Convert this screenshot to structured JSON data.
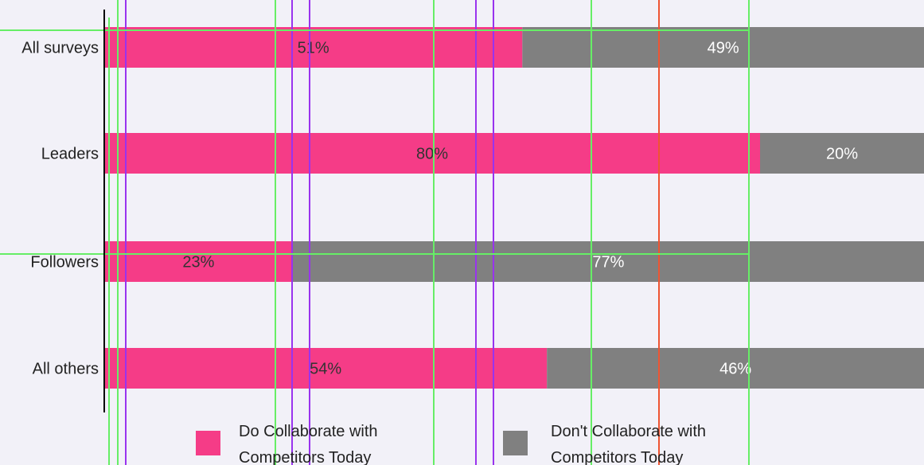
{
  "chart_data": {
    "type": "bar",
    "orientation": "horizontal",
    "stacked": true,
    "normalized_percent": true,
    "categories": [
      "All surveys",
      "Leaders",
      "Followers",
      "All others"
    ],
    "series": [
      {
        "name": "Do Collaborate with Competitors Today",
        "legend_lines": [
          "Do Collaborate with",
          "Competitors Today"
        ],
        "values": [
          51,
          80,
          23,
          54
        ],
        "labels": [
          "51%",
          "80%",
          "23%",
          "54%"
        ],
        "color": "#f53c87",
        "label_color": "#333333"
      },
      {
        "name": "Don't Collaborate with Competitors Today",
        "legend_lines": [
          "Don't Collaborate with",
          "Competitors Today"
        ],
        "values": [
          49,
          20,
          77,
          46
        ],
        "labels": [
          "49%",
          "20%",
          "77%",
          "46%"
        ],
        "color": "#808080",
        "label_color": "#ffffff"
      }
    ],
    "xlim": [
      0,
      100
    ],
    "title": "",
    "xlabel": "",
    "ylabel": "",
    "grid": false,
    "legend_position": "bottom",
    "background_color": "#f2f1f8",
    "axis_color": "#000000",
    "overlay_guides": {
      "green": "#66ee66",
      "purple": "#9933ee",
      "red": "#ee5533"
    }
  }
}
